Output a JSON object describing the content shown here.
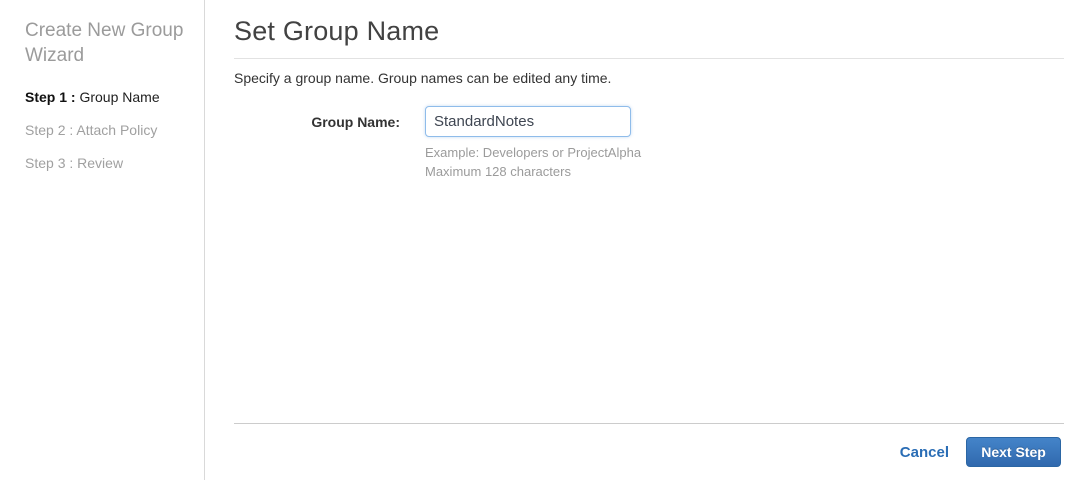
{
  "sidebar": {
    "title": "Create New Group Wizard",
    "steps": [
      {
        "prefix": "Step 1 :",
        "label": "Group Name"
      },
      {
        "prefix": "Step 2 :",
        "label": "Attach Policy"
      },
      {
        "prefix": "Step 3 :",
        "label": "Review"
      }
    ]
  },
  "main": {
    "title": "Set Group Name",
    "description": "Specify a group name. Group names can be edited any time.",
    "form": {
      "group_name_label": "Group Name:",
      "group_name_value": "StandardNotes",
      "hint_example": "Example: Developers or ProjectAlpha",
      "hint_max": "Maximum 128 characters"
    },
    "footer": {
      "cancel_label": "Cancel",
      "next_label": "Next Step"
    }
  },
  "colors": {
    "link_blue": "#2a6db5",
    "button_blue_top": "#4484c9",
    "button_blue_bottom": "#3069ae",
    "muted_gray": "#9b9b9b",
    "input_border_blue": "#8fbcea",
    "divider_gray": "#cccccc"
  }
}
